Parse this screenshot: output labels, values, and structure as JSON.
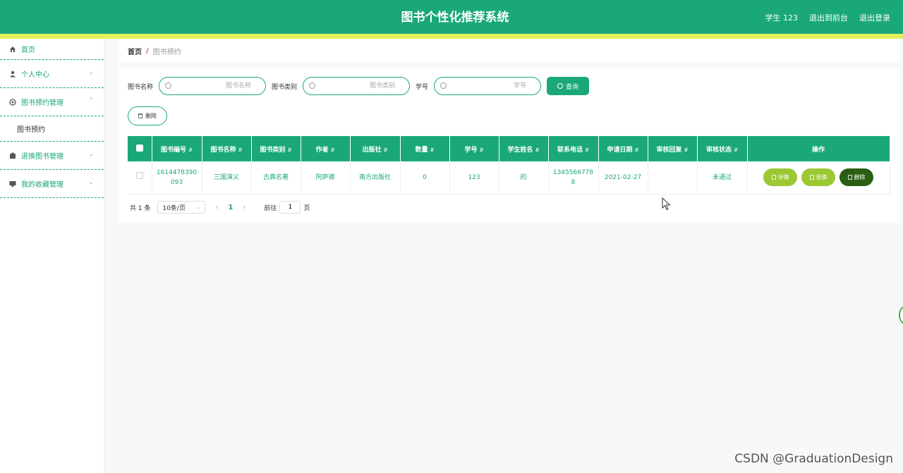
{
  "header": {
    "title": "图书个性化推荐系统",
    "user": "学生 123",
    "back_to_front": "退出到前台",
    "logout": "退出登录"
  },
  "sidebar": {
    "items": [
      {
        "label": "首页",
        "icon": "home-icon"
      },
      {
        "label": "个人中心",
        "icon": "user-icon"
      },
      {
        "label": "图书预约管理",
        "icon": "gear-icon"
      },
      {
        "label": "退换图书管理",
        "icon": "box-icon"
      },
      {
        "label": "我的收藏管理",
        "icon": "monitor-icon"
      }
    ],
    "sub_item": "图书预约"
  },
  "breadcrumb": {
    "home": "首页",
    "separator": "/",
    "current": "图书预约"
  },
  "search": {
    "label1": "图书名称",
    "placeholder1": "图书名称",
    "label2": "图书类别",
    "placeholder2": "图书类别",
    "label3": "学号",
    "placeholder3": "学号",
    "query_label": "查询"
  },
  "delete_button": "删除",
  "table": {
    "headers": [
      "图书编号",
      "图书名称",
      "图书类别",
      "作者",
      "出版社",
      "数量",
      "学号",
      "学生姓名",
      "联系电话",
      "申请日期",
      "审核回复",
      "审核状态",
      "操作"
    ],
    "rows": [
      {
        "book_id": "1614478390093",
        "book_name": "三国演义",
        "category": "古典名著",
        "author": "阿萨德",
        "publisher": "南方出版社",
        "quantity": "0",
        "student_id": "123",
        "student_name": "的",
        "phone": "13455667788",
        "date": "2021-02-27",
        "reply": "",
        "status": "未通过",
        "op_detail": "详情",
        "op_return": "退换",
        "op_delete": "删除"
      }
    ]
  },
  "pager": {
    "total": "共 1 条",
    "page_size": "10条/页",
    "current_page": "1",
    "goto_label": "前往",
    "goto_value": "1",
    "page_suffix": "页"
  },
  "watermark": "CSDN @GraduationDesign",
  "colors": {
    "primary": "#1aa87a",
    "accent_strip": "#e6f05b",
    "op_green": "#9cc832",
    "op_dark": "#2a5e12"
  }
}
